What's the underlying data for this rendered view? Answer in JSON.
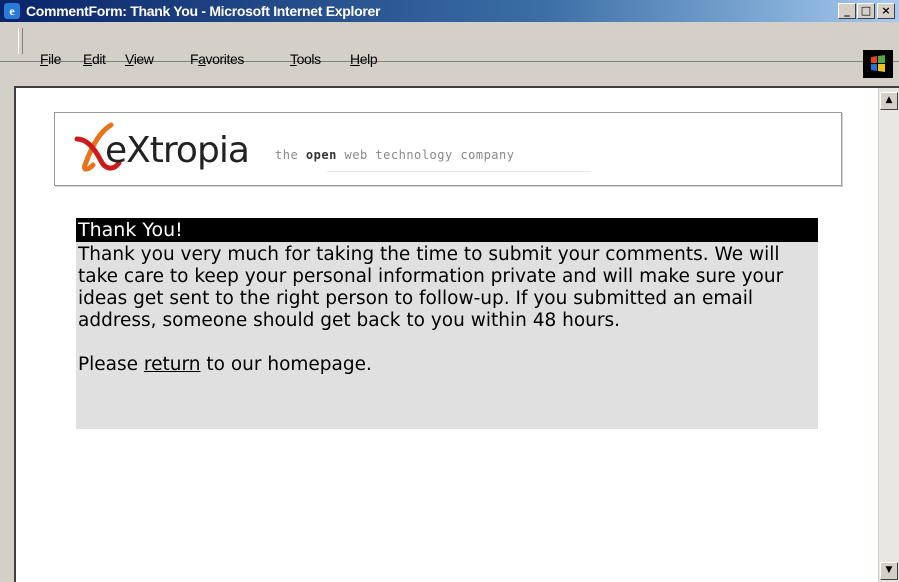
{
  "window": {
    "title": "CommentForm: Thank You - Microsoft Internet Explorer",
    "minimize_label": "_",
    "maximize_label": "□",
    "close_label": "×"
  },
  "menubar": {
    "items": [
      {
        "mnemonic": "F",
        "rest": "ile"
      },
      {
        "mnemonic": "E",
        "rest": "dit"
      },
      {
        "mnemonic": "V",
        "rest": "iew"
      },
      {
        "prefix": "F",
        "mnemonic": "a",
        "rest": "vorites"
      },
      {
        "mnemonic": "T",
        "rest": "ools"
      },
      {
        "mnemonic": "H",
        "rest": "elp"
      }
    ]
  },
  "logo": {
    "wordmark": "eXtropia",
    "tagline_pre": "the ",
    "tagline_bold": "open",
    "tagline_post": " web technology company",
    "brand_color": "#e8731a",
    "brand_red": "#cc1b1b"
  },
  "page": {
    "heading": "Thank You!",
    "message": "Thank you very much for taking the time to submit your comments. We will take care to keep your personal information private and will make sure your ideas get sent to the right person to follow-up. If you submitted an email address, someone should get back to you within 48 hours.",
    "return_prefix": "Please ",
    "return_link": "return",
    "return_suffix": " to our homepage."
  },
  "scrollbar": {
    "up_icon": "▲",
    "down_icon": "▼"
  }
}
